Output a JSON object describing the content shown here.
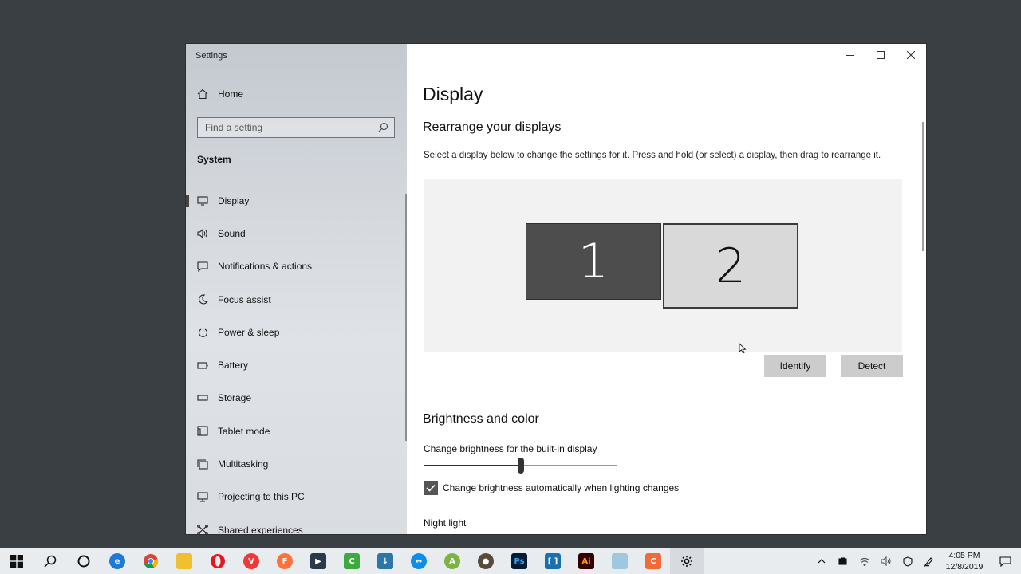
{
  "window": {
    "title": "Settings"
  },
  "sidebar": {
    "home_label": "Home",
    "search_placeholder": "Find a setting",
    "section_label": "System",
    "items": [
      {
        "label": "Display",
        "icon": "monitor-icon",
        "active": true
      },
      {
        "label": "Sound",
        "icon": "speaker-icon"
      },
      {
        "label": "Notifications & actions",
        "icon": "notification-icon"
      },
      {
        "label": "Focus assist",
        "icon": "moon-icon"
      },
      {
        "label": "Power & sleep",
        "icon": "power-icon"
      },
      {
        "label": "Battery",
        "icon": "battery-icon"
      },
      {
        "label": "Storage",
        "icon": "storage-icon"
      },
      {
        "label": "Tablet mode",
        "icon": "tablet-icon"
      },
      {
        "label": "Multitasking",
        "icon": "multitasking-icon"
      },
      {
        "label": "Projecting to this PC",
        "icon": "projecting-icon"
      },
      {
        "label": "Shared experiences",
        "icon": "shared-experiences-icon"
      }
    ]
  },
  "main": {
    "title": "Display",
    "rearrange": {
      "heading": "Rearrange your displays",
      "description": "Select a display below to change the settings for it. Press and hold (or select) a display, then drag to rearrange it.",
      "monitors": [
        {
          "number": "1",
          "selected": true
        },
        {
          "number": "2",
          "selected": false
        }
      ],
      "identify_label": "Identify",
      "detect_label": "Detect"
    },
    "brightness": {
      "heading": "Brightness and color",
      "slider_label": "Change brightness for the built-in display",
      "level_percent": 50,
      "auto_checkbox_label": "Change brightness automatically when lighting changes",
      "auto_checked": true,
      "night_light_label": "Night light"
    }
  },
  "taskbar": {
    "apps": [
      "start-icon",
      "search-icon",
      "cortana-icon",
      "edge-icon",
      "chrome-icon",
      "file-explorer-icon",
      "opera-icon",
      "vivaldi-icon",
      "firefox-icon",
      "app-icon",
      "camtasia-icon",
      "download-icon",
      "teamviewer-icon",
      "android-studio-icon",
      "app-icon",
      "photoshop-icon",
      "brackets-icon",
      "illustrator-icon",
      "app-icon",
      "app-icon",
      "settings-icon"
    ],
    "clock": {
      "time": "4:05 PM",
      "date": "12/8/2019"
    }
  },
  "colors": {
    "desktop": "#3a3f44",
    "sidebar": "#d5d9de",
    "monitor_selected": "#4d4d4d",
    "monitor_unselected": "#d9d9d9",
    "button": "#cccccc"
  }
}
